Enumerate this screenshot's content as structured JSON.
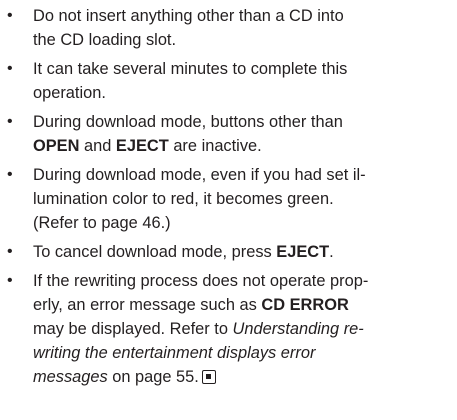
{
  "notes": [
    {
      "lines": [
        [
          "Do not insert anything other than a CD into"
        ],
        [
          "the CD loading slot."
        ]
      ]
    },
    {
      "lines": [
        [
          "It can take several minutes to complete this"
        ],
        [
          "operation."
        ]
      ]
    },
    {
      "line1": "During download mode, buttons other than",
      "bold1": "OPEN",
      "and": " and ",
      "bold2": "EJECT",
      "tail": " are inactive."
    },
    {
      "line1": "During download mode, even if you had set il-",
      "line2": "lumination color to red, it becomes green.",
      "line3": "(Refer to page 46.)"
    },
    {
      "text": "To cancel download mode, press ",
      "bold": "EJECT",
      "end": "."
    },
    {
      "line1": "If the rewriting process does not operate prop-",
      "line2a": "erly, an error message such as ",
      "line2b": "CD ERROR",
      "line3a": "may be displayed. Refer to ",
      "line3b": "Understanding re-",
      "line4": "writing the entertainment displays error",
      "line5a": "messages",
      "line5b": " on page 55."
    }
  ],
  "bullet": "•",
  "icons": {
    "end_of_section": "end-of-section-mark-icon"
  }
}
